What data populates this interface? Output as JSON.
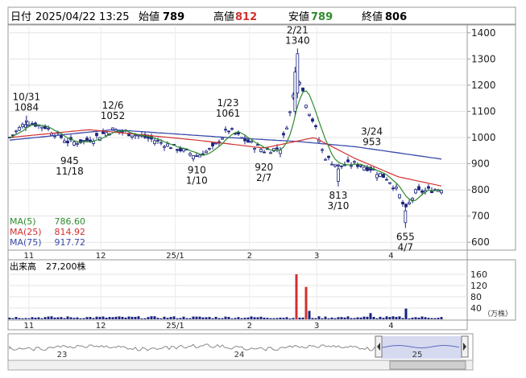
{
  "header": {
    "date_label": "日付",
    "datetime": "2025/04/22 13:25",
    "open_label": "始値",
    "open_value": "789",
    "high_label": "高値",
    "high_value": "812",
    "low_label": "安値",
    "low_value": "789",
    "close_label": "終値",
    "close_value": "806"
  },
  "colors": {
    "candle": "#1a237e",
    "ma5": "#2e8b2e",
    "ma25": "#d32f2f",
    "ma75": "#3949ab",
    "volume": "#1a237e",
    "volume_spike": "#d32f2f",
    "high_value": "#d32f2f",
    "low_value": "#2e8b2e"
  },
  "ma_legend": [
    {
      "name": "MA(5)",
      "value": "786.60"
    },
    {
      "name": "MA(25)",
      "value": "814.92"
    },
    {
      "name": "MA(75)",
      "value": "917.72"
    }
  ],
  "price_axis": {
    "ticks": [
      "1400",
      "1300",
      "1200",
      "1100",
      "1000",
      "900",
      "800",
      "700",
      "600"
    ],
    "range": [
      570,
      1430
    ]
  },
  "x_labels": [
    "11",
    "12",
    "25/1",
    "2",
    "3",
    "4"
  ],
  "annotations": [
    {
      "date": "10/31",
      "value": "1084",
      "pos": "above"
    },
    {
      "date": "11/18",
      "value": "945",
      "pos": "below"
    },
    {
      "date": "12/6",
      "value": "1052",
      "pos": "above"
    },
    {
      "date": "1/10",
      "value": "910",
      "pos": "below"
    },
    {
      "date": "1/23",
      "value": "1061",
      "pos": "above"
    },
    {
      "date": "2/7",
      "value": "920",
      "pos": "below"
    },
    {
      "date": "2/21",
      "value": "1340",
      "pos": "above"
    },
    {
      "date": "3/10",
      "value": "813",
      "pos": "below"
    },
    {
      "date": "3/24",
      "value": "953",
      "pos": "above"
    },
    {
      "date": "4/7",
      "value": "655",
      "pos": "below"
    }
  ],
  "volume": {
    "title": "出来高",
    "value": "27,200株",
    "ticks": [
      "160",
      "120",
      "80",
      "40"
    ],
    "unit": "（万株）",
    "range": [
      0,
      180
    ]
  },
  "navigator": {
    "labels": [
      "23",
      "24",
      "25"
    ]
  },
  "chart_data": {
    "type": "candlestick",
    "anchors": [
      {
        "date": "2024/10/24",
        "close": 1000
      },
      {
        "date": "2024/10/31",
        "close": 1060
      },
      {
        "date": "2024/11/08",
        "close": 1040
      },
      {
        "date": "2024/11/18",
        "close": 980
      },
      {
        "date": "2024/11/26",
        "close": 990
      },
      {
        "date": "2024/12/06",
        "close": 1030
      },
      {
        "date": "2024/12/16",
        "close": 1010
      },
      {
        "date": "2024/12/25",
        "close": 985
      },
      {
        "date": "2025/01/10",
        "close": 930
      },
      {
        "date": "2025/01/17",
        "close": 960
      },
      {
        "date": "2025/01/23",
        "close": 1030
      },
      {
        "date": "2025/01/31",
        "close": 985
      },
      {
        "date": "2025/02/07",
        "close": 950
      },
      {
        "date": "2025/02/14",
        "close": 960
      },
      {
        "date": "2025/02/18",
        "close": 1100
      },
      {
        "date": "2025/02/21",
        "close": 1250
      },
      {
        "date": "2025/02/25",
        "close": 1120
      },
      {
        "date": "2025/02/28",
        "close": 1050
      },
      {
        "date": "2025/03/04",
        "close": 930
      },
      {
        "date": "2025/03/10",
        "close": 890
      },
      {
        "date": "2025/03/17",
        "close": 900
      },
      {
        "date": "2025/03/24",
        "close": 880
      },
      {
        "date": "2025/03/31",
        "close": 840
      },
      {
        "date": "2025/04/04",
        "close": 790
      },
      {
        "date": "2025/04/07",
        "close": 720
      },
      {
        "date": "2025/04/11",
        "close": 790
      },
      {
        "date": "2025/04/22",
        "close": 806
      }
    ],
    "ma75_anchors": [
      {
        "date": "2024/10/24",
        "value": 990
      },
      {
        "date": "2024/12/06",
        "value": 1030
      },
      {
        "date": "2025/01/23",
        "value": 1000
      },
      {
        "date": "2025/02/21",
        "value": 985
      },
      {
        "date": "2025/03/17",
        "value": 965
      },
      {
        "date": "2025/04/22",
        "value": 917.72
      }
    ],
    "ma25_anchors": [
      {
        "date": "2024/10/24",
        "value": 1000
      },
      {
        "date": "2024/11/26",
        "value": 1030
      },
      {
        "date": "2025/01/10",
        "value": 990
      },
      {
        "date": "2025/02/07",
        "value": 960
      },
      {
        "date": "2025/02/28",
        "value": 1000
      },
      {
        "date": "2025/03/17",
        "value": 920
      },
      {
        "date": "2025/04/04",
        "value": 850
      },
      {
        "date": "2025/04/22",
        "value": 814.92
      }
    ],
    "volume_spikes": [
      {
        "date": "2025/02/21",
        "value": 160
      },
      {
        "date": "2025/02/24",
        "value": 115
      },
      {
        "date": "2025/02/25",
        "value": 45
      },
      {
        "date": "2025/02/26",
        "value": 30
      },
      {
        "date": "2025/04/07",
        "value": 38
      },
      {
        "date": "2025/03/24",
        "value": 22
      }
    ]
  }
}
